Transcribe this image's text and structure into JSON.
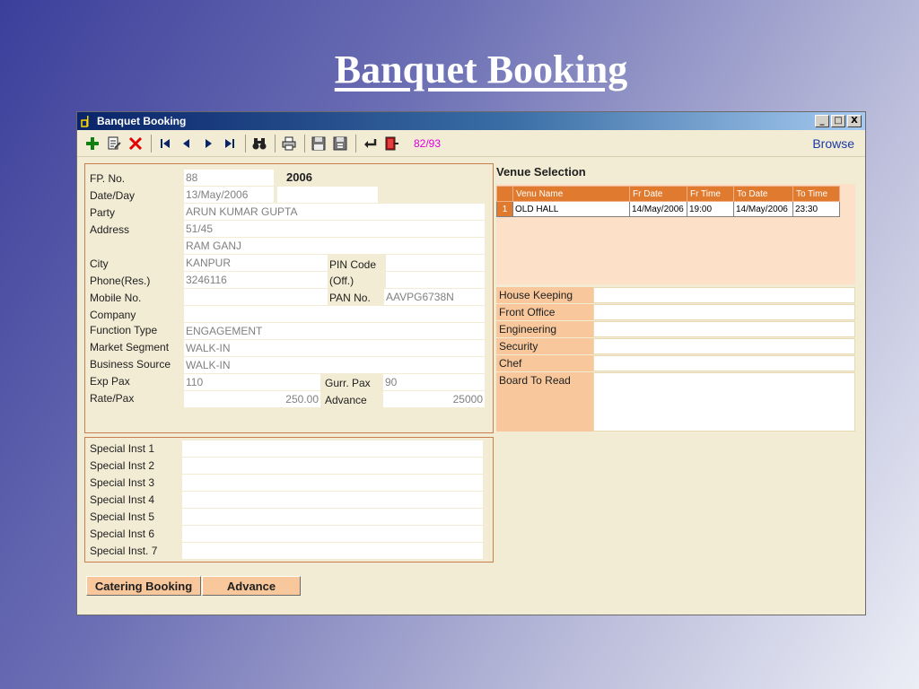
{
  "slide": {
    "title": "Banquet Booking"
  },
  "window": {
    "title": "Banquet Booking",
    "buttons": {
      "minimize": "_",
      "maximize": "□",
      "close": "X"
    }
  },
  "toolbar": {
    "record_counter": "82/93",
    "browse_label": "Browse"
  },
  "form": {
    "fp_no": {
      "label": "FP. No.",
      "value": "88",
      "year": "2006"
    },
    "date_day": {
      "label": "Date/Day",
      "value": "13/May/2006",
      "day": ""
    },
    "party": {
      "label": "Party",
      "value": "ARUN KUMAR GUPTA"
    },
    "address": {
      "label": "Address",
      "line1": "51/45",
      "line2": "RAM GANJ"
    },
    "city": {
      "label": "City",
      "value": "KANPUR"
    },
    "pin_code": {
      "label": "PIN Code",
      "value": ""
    },
    "phone_res": {
      "label": "Phone(Res.)",
      "value": "3246116"
    },
    "phone_off": {
      "label": "(Off.)",
      "value": ""
    },
    "mobile": {
      "label": "Mobile No.",
      "value": ""
    },
    "pan": {
      "label": "PAN No.",
      "value": "AAVPG6738N"
    },
    "company": {
      "label": "Company",
      "value": ""
    },
    "function_type": {
      "label": "Function Type",
      "value": "ENGAGEMENT"
    },
    "market_segment": {
      "label": "Market Segment",
      "value": "WALK-IN"
    },
    "business_source": {
      "label": "Business Source",
      "value": "WALK-IN"
    },
    "exp_pax": {
      "label": "Exp Pax",
      "value": "110"
    },
    "gurr_pax": {
      "label": "Gurr. Pax",
      "value": "90"
    },
    "rate_pax": {
      "label": "Rate/Pax",
      "value": "250.00"
    },
    "advance": {
      "label": "Advance",
      "value": "25000"
    }
  },
  "special_instructions": [
    {
      "label": "Special Inst 1",
      "value": ""
    },
    {
      "label": "Special Inst 2",
      "value": ""
    },
    {
      "label": "Special Inst 3",
      "value": ""
    },
    {
      "label": "Special Inst 4",
      "value": ""
    },
    {
      "label": "Special Inst 5",
      "value": ""
    },
    {
      "label": "Special Inst 6",
      "value": ""
    },
    {
      "label": "Special Inst. 7",
      "value": ""
    }
  ],
  "venue": {
    "title": "Venue Selection",
    "columns": [
      "",
      "Venu Name",
      "Fr Date",
      "Fr Time",
      "To Date",
      "To Time"
    ],
    "rows": [
      [
        "1",
        "OLD HALL",
        "14/May/2006",
        "19:00",
        "14/May/2006",
        "23:30"
      ]
    ]
  },
  "departments": [
    {
      "label": "House Keeping",
      "value": ""
    },
    {
      "label": "Front Office",
      "value": ""
    },
    {
      "label": "Engineering",
      "value": ""
    },
    {
      "label": "Security",
      "value": ""
    },
    {
      "label": "Chef",
      "value": ""
    },
    {
      "label": "Board To Read",
      "value": ""
    }
  ],
  "actions": {
    "catering": "Catering Booking",
    "advance": "Advance"
  },
  "colors": {
    "accent": "#e07a2e",
    "label_bg": "#f8c89c",
    "window_bg": "#f3ecd5",
    "counter": "#e000e0"
  }
}
